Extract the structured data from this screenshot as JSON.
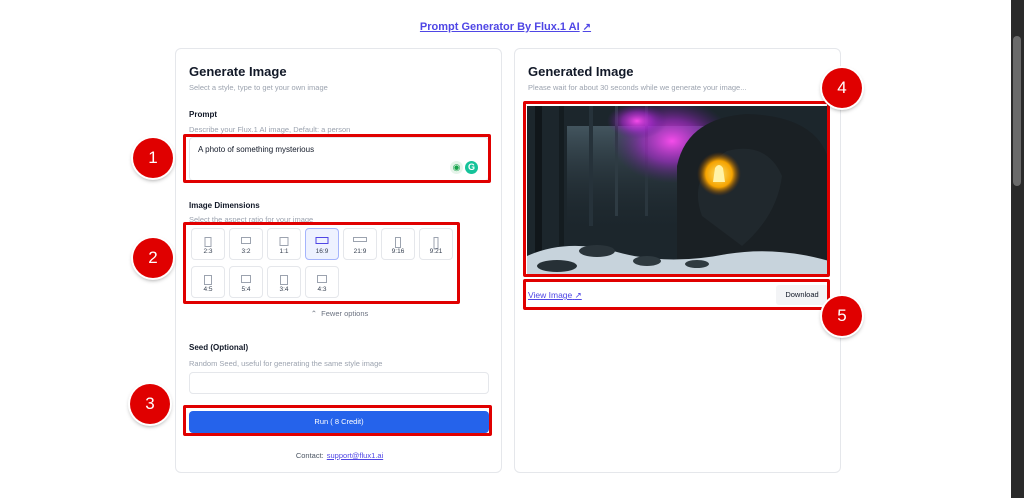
{
  "top_link": {
    "label": "Prompt Generator By Flux.1 AI",
    "icon": "external-link-icon"
  },
  "left_card": {
    "title": "Generate Image",
    "subtitle": "Select a style, type to get your own image",
    "prompt": {
      "label": "Prompt",
      "hint": "Describe your Flux.1 AI image, Default: a person",
      "value": "A photo of something mysterious"
    },
    "dimensions": {
      "label": "Image Dimensions",
      "hint": "Select the aspect ratio for your image",
      "ratios": [
        {
          "label": "2:3",
          "selected": false
        },
        {
          "label": "3:2",
          "selected": false
        },
        {
          "label": "1:1",
          "selected": false
        },
        {
          "label": "16:9",
          "selected": true
        },
        {
          "label": "21:9",
          "selected": false
        },
        {
          "label": "9:16",
          "selected": false
        },
        {
          "label": "9:21",
          "selected": false
        },
        {
          "label": "4:5",
          "selected": false
        },
        {
          "label": "5:4",
          "selected": false
        },
        {
          "label": "3:4",
          "selected": false
        },
        {
          "label": "4:3",
          "selected": false
        }
      ],
      "toggle_label": "Fewer options"
    },
    "seed": {
      "label": "Seed (Optional)",
      "hint": "Random Seed, useful for generating the same style image",
      "value": ""
    },
    "run_button": "Run   ( 8 Credit)",
    "contact": {
      "label": "Contact:",
      "email": "support@flux1.ai"
    }
  },
  "right_card": {
    "title": "Generated Image",
    "subtitle": "Please wait for about 30 seconds while we generate your image...",
    "view_image": "View Image",
    "download": "Download"
  },
  "badges": [
    "1",
    "2",
    "3",
    "4",
    "5"
  ],
  "colors": {
    "accent": "#2563eb",
    "link": "#4f46e5",
    "highlight": "#e00000"
  }
}
